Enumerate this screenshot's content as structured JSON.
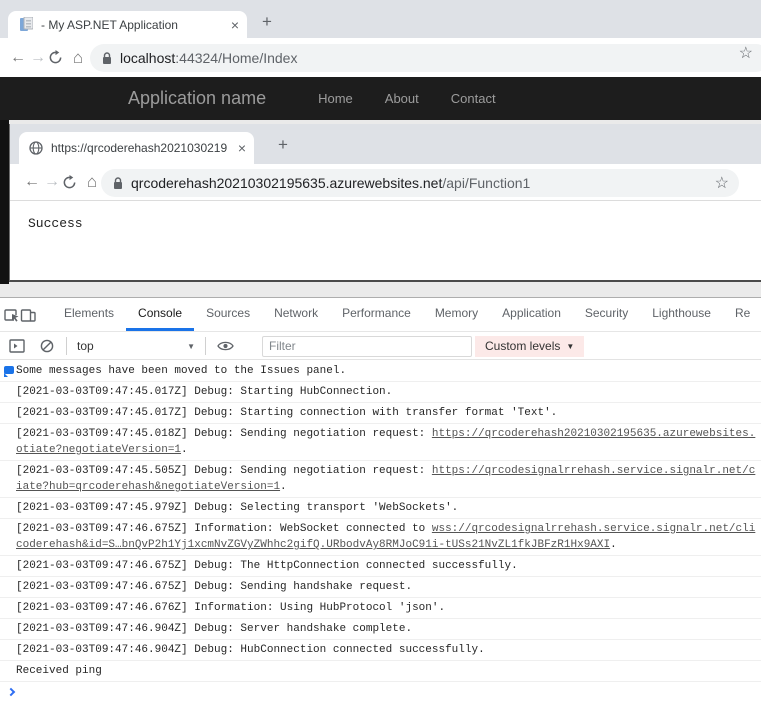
{
  "colors": {
    "accent_blue": "#1a73e8",
    "custom_levels_bg": "#fce9e8",
    "prompt_blue": "#2f6ef2"
  },
  "icons": {
    "back": "←",
    "forward": "→",
    "home": "⌂",
    "star": "☆",
    "close": "×",
    "new_tab": "+",
    "dropdown_arrow": "▼"
  },
  "browser1": {
    "tab_title": "- My ASP.NET Application",
    "url_host": "localhost",
    "url_rest": ":44324/Home/Index"
  },
  "site_nav": {
    "brand": "Application name",
    "links": [
      "Home",
      "About",
      "Contact"
    ]
  },
  "browser2": {
    "tab_title": "https://qrcoderehash2021030219",
    "url_host": "qrcoderehash20210302195635.azurewebsites.net",
    "url_path": "/api/Function1",
    "page_text": "Success"
  },
  "devtools": {
    "tabs": [
      {
        "label": "Elements",
        "active": false
      },
      {
        "label": "Console",
        "active": true
      },
      {
        "label": "Sources",
        "active": false
      },
      {
        "label": "Network",
        "active": false
      },
      {
        "label": "Performance",
        "active": false
      },
      {
        "label": "Memory",
        "active": false
      },
      {
        "label": "Application",
        "active": false
      },
      {
        "label": "Security",
        "active": false
      },
      {
        "label": "Lighthouse",
        "active": false
      },
      {
        "label": "Re",
        "active": false
      }
    ],
    "toolbar": {
      "context": "top",
      "filter_placeholder": "Filter",
      "custom_levels_label": "Custom levels"
    },
    "console_messages": [
      {
        "icon": "issues-bubble",
        "lines": [
          [
            {
              "t": "Some messages have been moved to the Issues panel."
            }
          ]
        ]
      },
      {
        "lines": [
          [
            {
              "t": "[2021-03-03T09:47:45.017Z] Debug: Starting HubConnection."
            }
          ]
        ]
      },
      {
        "lines": [
          [
            {
              "t": "[2021-03-03T09:47:45.017Z] Debug: Starting connection with transfer format 'Text'."
            }
          ]
        ]
      },
      {
        "lines": [
          [
            {
              "t": "[2021-03-03T09:47:45.018Z] Debug: Sending negotiation request: "
            },
            {
              "t": "https://qrcoderehash20210302195635.azurewebsites.",
              "link": true
            }
          ],
          [
            {
              "t": "otiate?negotiateVersion=1",
              "link": true
            },
            {
              "t": "."
            }
          ]
        ]
      },
      {
        "lines": [
          [
            {
              "t": "[2021-03-03T09:47:45.505Z] Debug: Sending negotiation request: "
            },
            {
              "t": "https://qrcodesignalrrehash.service.signalr.net/c",
              "link": true
            }
          ],
          [
            {
              "t": "iate?hub=qrcoderehash&negotiateVersion=1",
              "link": true
            },
            {
              "t": "."
            }
          ]
        ]
      },
      {
        "lines": [
          [
            {
              "t": "[2021-03-03T09:47:45.979Z] Debug: Selecting transport 'WebSockets'."
            }
          ]
        ]
      },
      {
        "lines": [
          [
            {
              "t": "[2021-03-03T09:47:46.675Z] Information: WebSocket connected to "
            },
            {
              "t": "wss://qrcodesignalrrehash.service.signalr.net/cli",
              "link": true
            }
          ],
          [
            {
              "t": "coderehash&id=S…bnQvP2h1Yj1xcmNvZGVyZWhhc2gifQ.URbodvAy8RMJoC91i-tUSs21NvZL1fkJBFzR1Hx9AXI",
              "link": true
            },
            {
              "t": "."
            }
          ]
        ]
      },
      {
        "lines": [
          [
            {
              "t": "[2021-03-03T09:47:46.675Z] Debug: The HttpConnection connected successfully."
            }
          ]
        ]
      },
      {
        "lines": [
          [
            {
              "t": "[2021-03-03T09:47:46.675Z] Debug: Sending handshake request."
            }
          ]
        ]
      },
      {
        "lines": [
          [
            {
              "t": "[2021-03-03T09:47:46.676Z] Information: Using HubProtocol 'json'."
            }
          ]
        ]
      },
      {
        "lines": [
          [
            {
              "t": "[2021-03-03T09:47:46.904Z] Debug: Server handshake complete."
            }
          ]
        ]
      },
      {
        "lines": [
          [
            {
              "t": "[2021-03-03T09:47:46.904Z] Debug: HubConnection connected successfully."
            }
          ]
        ]
      },
      {
        "lines": [
          [
            {
              "t": "Received ping"
            }
          ]
        ]
      }
    ]
  }
}
